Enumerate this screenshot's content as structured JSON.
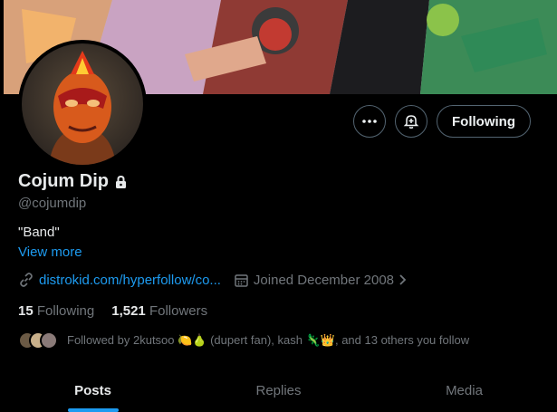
{
  "profile": {
    "display_name": "Cojum Dip",
    "handle": "@cojumdip",
    "bio": "\"Band\"",
    "view_more": "View more",
    "link": "distrokid.com/hyperfollow/co...",
    "joined": "Joined December 2008",
    "following_count": "15",
    "following_label": "Following",
    "followers_count": "1,521",
    "followers_label": "Followers",
    "followed_by": "Followed by 2kutsoo 🍋🍐 (dupert fan), kash 🦎👑, and 13 others you follow"
  },
  "actions": {
    "more_icon": "more-icon",
    "notify_icon": "bell-plus-icon",
    "follow_label": "Following"
  },
  "tabs": [
    {
      "label": "Posts",
      "active": true
    },
    {
      "label": "Replies",
      "active": false
    },
    {
      "label": "Media",
      "active": false
    }
  ],
  "colors": {
    "accent": "#1d9bf0",
    "secondary_text": "#71767b",
    "primary_text": "#e7e9ea",
    "background": "#000000"
  }
}
